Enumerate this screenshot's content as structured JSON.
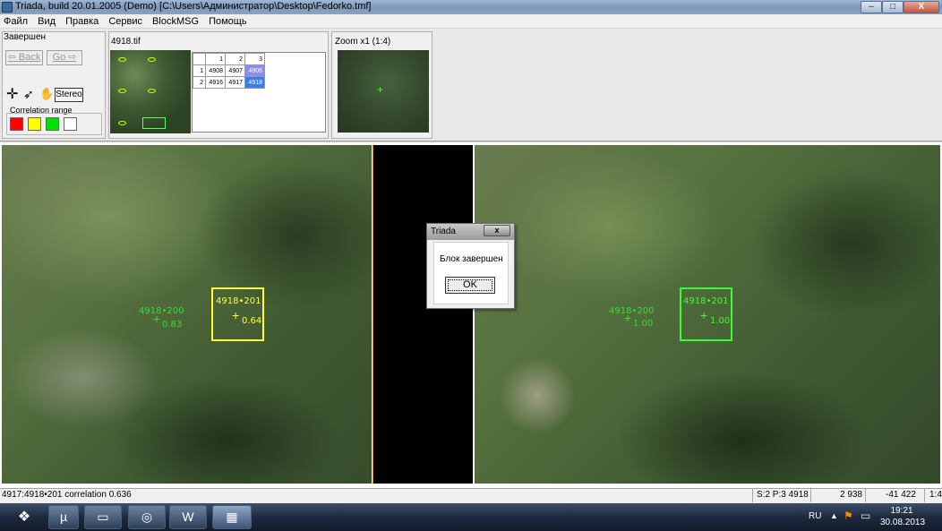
{
  "window": {
    "title": "Triada, build 20.01.2005 (Demo)  [C:\\Users\\Администратор\\Desktop\\Fedorko.tmf]",
    "min": "–",
    "max": "□",
    "close": "X"
  },
  "menu": [
    "Файл",
    "Вид",
    "Правка",
    "Сервис",
    "BlockMSG",
    "Помощь"
  ],
  "nav_panel": {
    "title": "Завершен",
    "back_label": "Back",
    "go_label": "Go",
    "stereo_label": "Stereo",
    "correlation_label": "Correlation range",
    "swatches": [
      "#ff0000",
      "#ffff00",
      "#00e000",
      "#ffffff"
    ]
  },
  "thumb_panel": {
    "title": "4918.tif",
    "grid": {
      "headers": [
        "",
        "1",
        "2",
        "3"
      ],
      "rows": [
        [
          "1",
          "4908",
          "4907",
          "4906"
        ],
        [
          "2",
          "4916",
          "4917",
          "4918"
        ]
      ]
    }
  },
  "zoom_panel": {
    "title": "Zoom x1 (1:4)"
  },
  "left_image": {
    "point_a": {
      "label": "4918•200",
      "value": "0.83",
      "color": "#33dd33"
    },
    "point_b": {
      "label": "4918•201",
      "value": "0.64",
      "color": "#ffff33"
    }
  },
  "right_image": {
    "point_a": {
      "label": "4918•200",
      "value": "1.00",
      "color": "#33dd33"
    },
    "point_b": {
      "label": "4918•201",
      "value": "1.00",
      "color": "#33ff33"
    }
  },
  "dialog": {
    "title": "Triada",
    "message": "Блок завершен",
    "ok_label": "OK",
    "close": "x"
  },
  "status": {
    "main": "4917:4918•201 correlation 0.636",
    "sp": "S:2  P:3  4918",
    "x": "2 938",
    "y": "-41 422",
    "scale": "1:4"
  },
  "taskbar": {
    "lang": "RU",
    "time": "19:21",
    "date": "30.08.2013"
  }
}
